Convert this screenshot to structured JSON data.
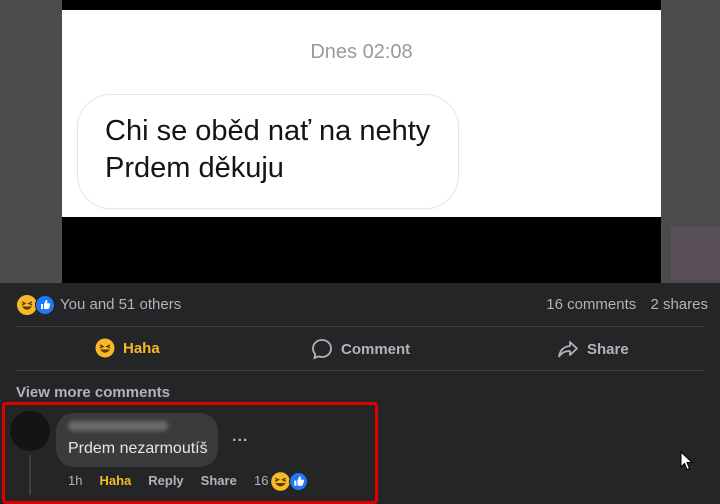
{
  "post_image": {
    "timestamp": "Dnes 02:08",
    "message_lines": [
      "Chi se oběd nať na nehty",
      "Prdem děkuju"
    ]
  },
  "stats": {
    "reactions_text": "You and 51 others",
    "comments_text": "16 comments",
    "shares_text": "2 shares"
  },
  "actions": {
    "haha": "Haha",
    "comment": "Comment",
    "share": "Share"
  },
  "comments": {
    "view_more": "View more comments",
    "item": {
      "text": "Prdem nezarmoutíš",
      "time": "1h",
      "haha": "Haha",
      "reply": "Reply",
      "share": "Share",
      "reaction_count": "16",
      "more": "..."
    }
  },
  "colors": {
    "background": "#242526",
    "haha_yellow": "#f7b928",
    "like_blue": "#2078f4",
    "highlight_red": "#e00000"
  }
}
